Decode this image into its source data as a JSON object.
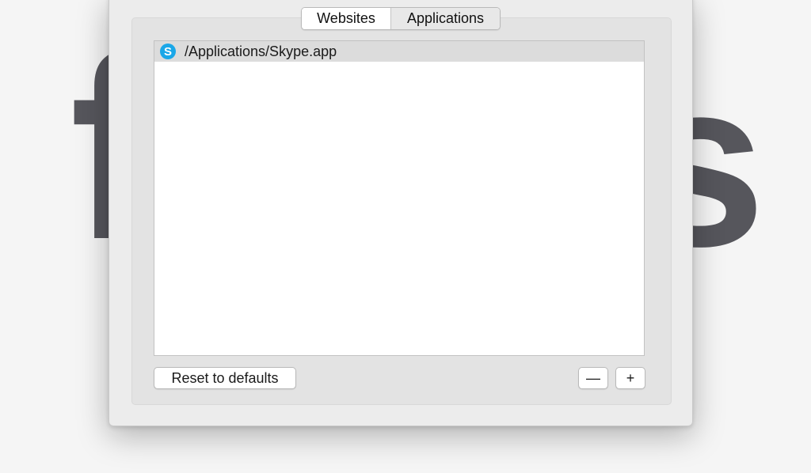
{
  "tabs": [
    {
      "label": "Websites",
      "selected": false
    },
    {
      "label": "Applications",
      "selected": true
    }
  ],
  "list": {
    "items": [
      {
        "icon": "skype-icon",
        "label": "/Applications/Skype.app",
        "selected": true
      }
    ]
  },
  "buttons": {
    "reset_label": "Reset to defaults",
    "remove_label": "—",
    "add_label": "+"
  },
  "colors": {
    "skype_blue": "#1aa7e8",
    "sheet_bg": "#ececec",
    "group_bg": "#e3e3e3",
    "selected_row": "#dcdcdc"
  }
}
